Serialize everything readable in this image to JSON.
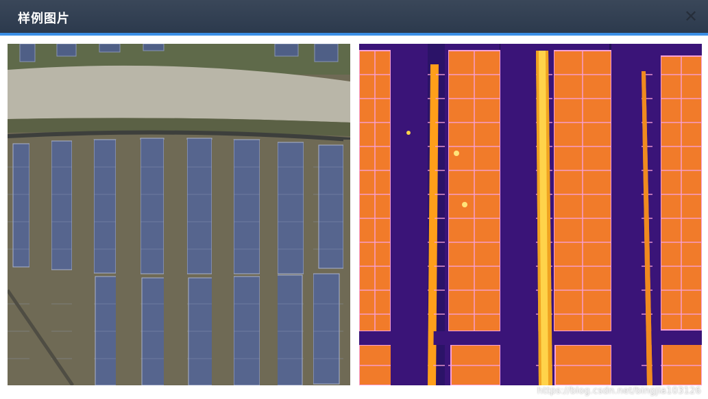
{
  "dialog": {
    "title": "样例图片",
    "close_symbol": "✕"
  },
  "images": {
    "visible_photo_alt": "",
    "thermal_photo_alt": ""
  },
  "watermark": {
    "text": "https://blog.csdn.net/bingjia103126"
  },
  "colors": {
    "header_bg": "#2f3c50",
    "header_accent": "#3b8fe6",
    "panel_bg": "#ffffff"
  }
}
